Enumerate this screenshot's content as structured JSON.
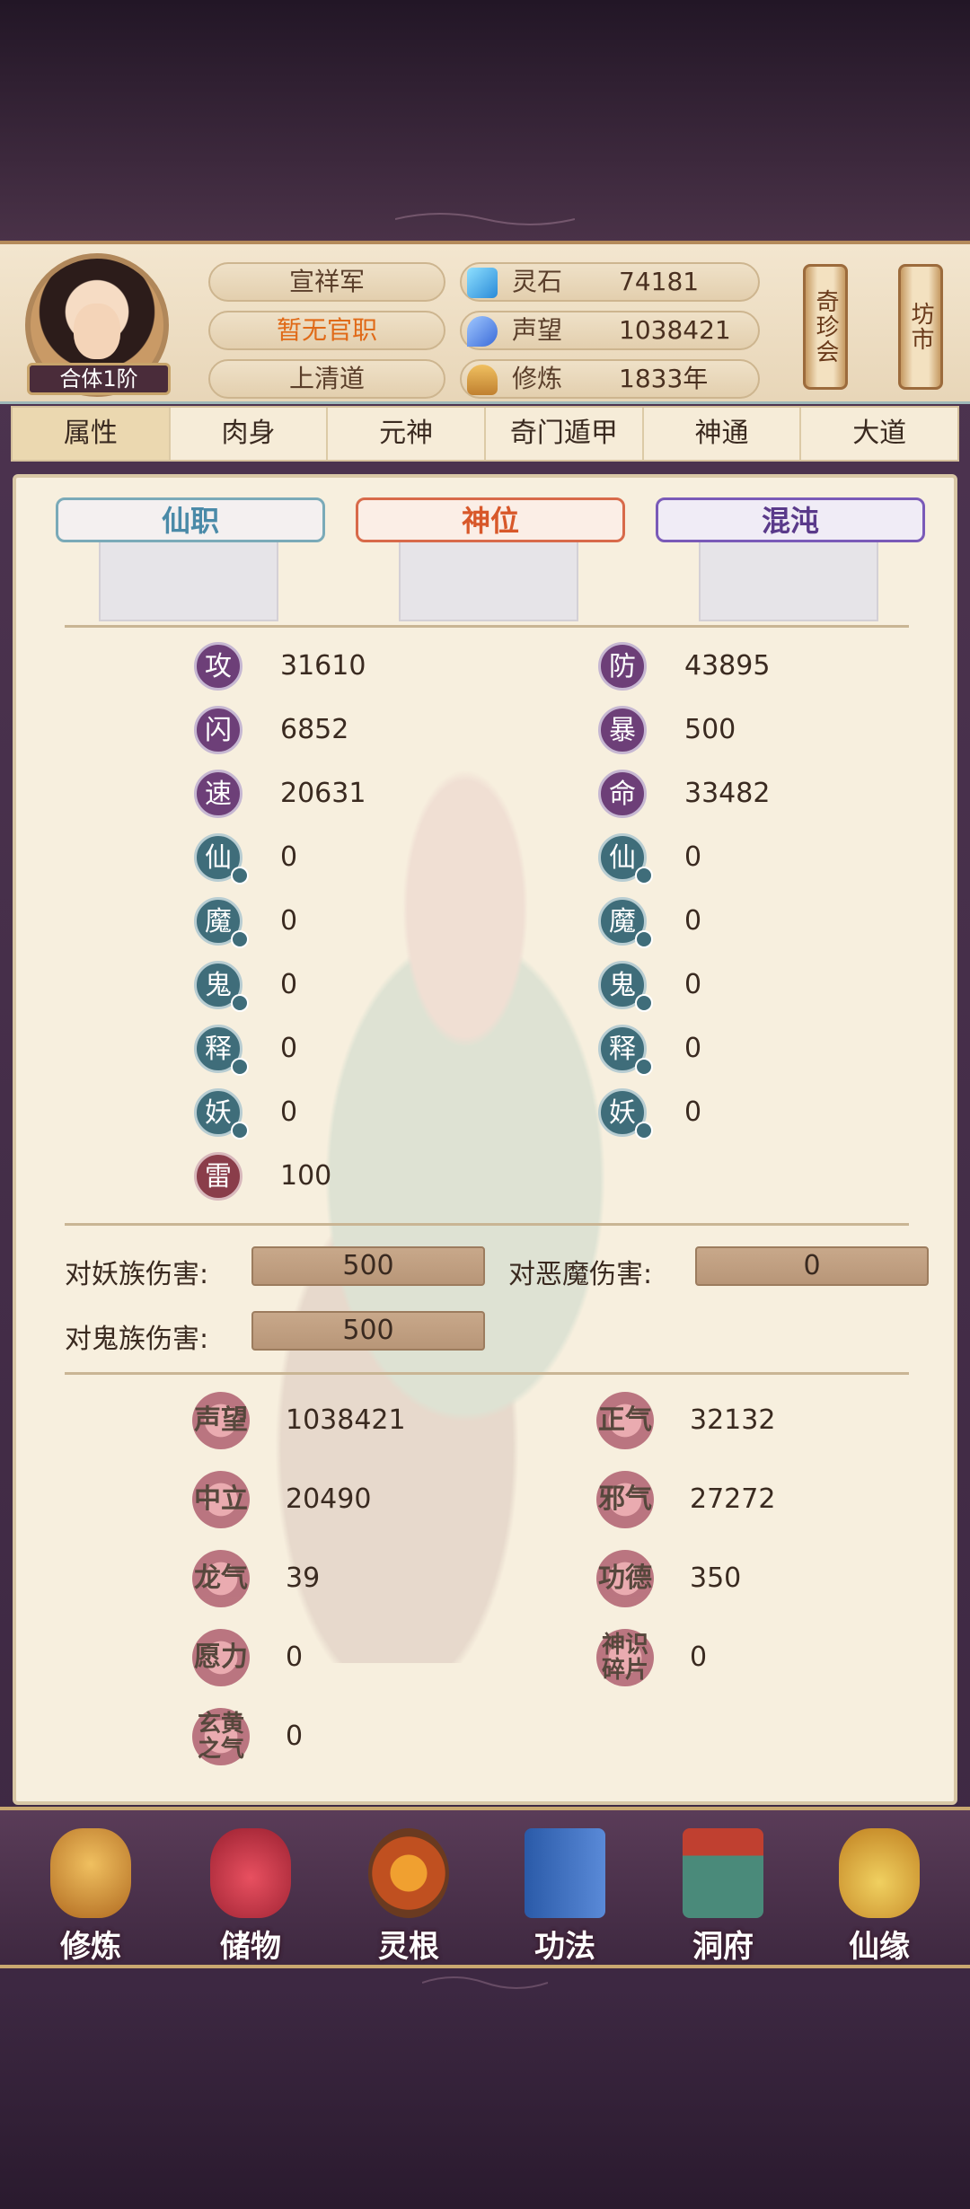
{
  "header": {
    "realm": "合体1阶",
    "sect_title": "宣祥军",
    "official_post": "暂无官职",
    "path": "上清道",
    "resources": [
      {
        "icon": "spirit-stone-icon",
        "label": "灵石",
        "value": "74181"
      },
      {
        "icon": "reputation-icon",
        "label": "声望",
        "value": "1038421"
      },
      {
        "icon": "cultivation-icon",
        "label": "修炼",
        "value": "1833年"
      }
    ],
    "treasure_shop": "奇珍会",
    "market": "坊市"
  },
  "tabs": [
    "属性",
    "肉身",
    "元神",
    "奇门遁甲",
    "神通",
    "大道"
  ],
  "ranks": {
    "immortal_post": "仙职",
    "divine_rank": "神位",
    "chaos": "混沌"
  },
  "stats_left": [
    {
      "glyph": "攻",
      "value": "31610"
    },
    {
      "glyph": "闪",
      "value": "6852"
    },
    {
      "glyph": "速",
      "value": "20631"
    },
    {
      "glyph": "仙",
      "value": "0"
    },
    {
      "glyph": "魔",
      "value": "0"
    },
    {
      "glyph": "鬼",
      "value": "0"
    },
    {
      "glyph": "释",
      "value": "0"
    },
    {
      "glyph": "妖",
      "value": "0"
    },
    {
      "glyph": "雷",
      "value": "100"
    }
  ],
  "stats_right": [
    {
      "glyph": "防",
      "value": "43895"
    },
    {
      "glyph": "暴",
      "value": "500"
    },
    {
      "glyph": "命",
      "value": "33482"
    },
    {
      "glyph": "仙",
      "value": "0"
    },
    {
      "glyph": "魔",
      "value": "0"
    },
    {
      "glyph": "鬼",
      "value": "0"
    },
    {
      "glyph": "释",
      "value": "0"
    },
    {
      "glyph": "妖",
      "value": "0"
    }
  ],
  "damage": {
    "vs_demon_beast_label": "对妖族伤害:",
    "vs_demon_beast_value": "500",
    "vs_evil_demon_label": "对恶魔伤害:",
    "vs_evil_demon_value": "0",
    "vs_ghost_label": "对鬼族伤害:",
    "vs_ghost_value": "500"
  },
  "virtues_left": [
    {
      "label": "声望",
      "value": "1038421"
    },
    {
      "label": "中立",
      "value": "20490"
    },
    {
      "label": "龙气",
      "value": "39"
    },
    {
      "label": "愿力",
      "value": "0"
    },
    {
      "label": "玄黄之气",
      "value": "0"
    }
  ],
  "virtues_right": [
    {
      "label": "正气",
      "value": "32132"
    },
    {
      "label": "邪气",
      "value": "27272"
    },
    {
      "label": "功德",
      "value": "350"
    },
    {
      "label": "神识碎片",
      "value": "0"
    }
  ],
  "bottom_nav": [
    {
      "label": "修炼",
      "icon": "monk-icon"
    },
    {
      "label": "储物",
      "icon": "bag-icon"
    },
    {
      "label": "灵根",
      "icon": "spirit-root-icon"
    },
    {
      "label": "功法",
      "icon": "book-icon"
    },
    {
      "label": "洞府",
      "icon": "cave-house-icon"
    },
    {
      "label": "仙缘",
      "icon": "gourd-icon"
    }
  ]
}
